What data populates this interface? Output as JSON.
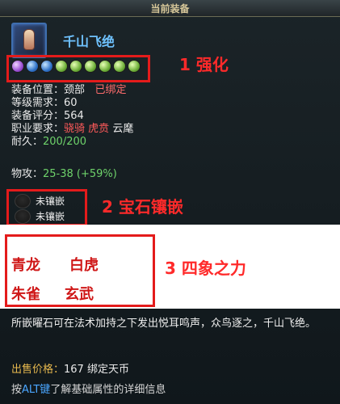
{
  "window": {
    "title": "当前装备"
  },
  "item": {
    "name": "千山飞绝",
    "gems": [
      "purple",
      "blue",
      "blue",
      "green",
      "green",
      "green",
      "green",
      "green",
      "green"
    ]
  },
  "stats": {
    "slot_label": "装备位置：",
    "slot_value": "颈部",
    "bound": "已绑定",
    "level_label": "等级需求：",
    "level_value": "60",
    "score_label": "装备评分：",
    "score_value": "564",
    "class_label": "职业要求：",
    "class_1": "骁骑",
    "class_2": "虎贲",
    "class_3": "云麾",
    "durability_label": "耐久：",
    "durability_value": "200/200"
  },
  "attack": {
    "label": "物攻：",
    "value": "25-38 (+59%)"
  },
  "sockets": [
    "未镶嵌",
    "未镶嵌"
  ],
  "beasts": [
    "青龙",
    "白虎",
    "朱雀",
    "玄武"
  ],
  "annotations": {
    "a1": "1 强化",
    "a2": "2  宝石镶嵌",
    "a3": "3  四象之力"
  },
  "description": "所嵌曜石可在法术加持之下发出悦耳鸣声，众鸟逐之，千山飞绝。",
  "price": {
    "label": "出售价格：",
    "value": "167",
    "currency": "绑定天币"
  },
  "hint": {
    "prefix": "按",
    "key": "ALT键",
    "suffix": "了解基础属性的详细信息"
  },
  "colors": {
    "accent": "#6fc2ff",
    "annotation": "#ff2a2a",
    "gold": "#e6b84e",
    "green": "#6ed26a"
  }
}
